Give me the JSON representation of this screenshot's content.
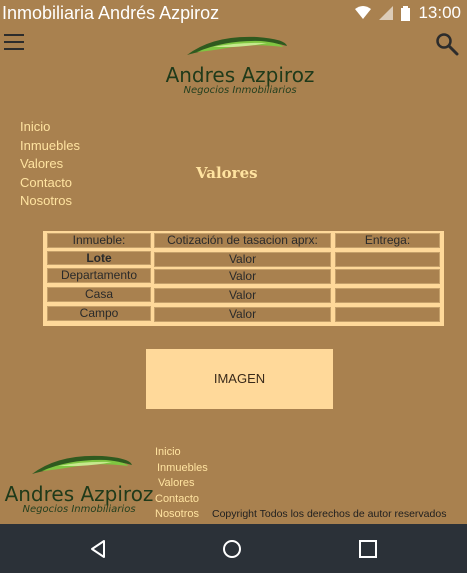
{
  "status_bar": {
    "title": "Inmobiliaria Andrés Azpiroz",
    "time": "13:00"
  },
  "logo": {
    "brand": "Andres Azpiroz",
    "tagline": "Negocios Inmobiliarios"
  },
  "side_nav": [
    "Inicio",
    "Inmuebles",
    "Valores",
    "Contacto",
    "Nosotros"
  ],
  "section_title": "Valores",
  "table": {
    "headers": [
      "Inmueble:",
      "Cotización de tasacion aprx:",
      "Entrega:"
    ],
    "rows": [
      {
        "inmueble": "Lote",
        "valor": "Valor",
        "entrega": ""
      },
      {
        "inmueble": "Departamento",
        "valor": "Valor",
        "entrega": ""
      },
      {
        "inmueble": "Casa",
        "valor": "Valor",
        "entrega": ""
      },
      {
        "inmueble": "Campo",
        "valor": "Valor",
        "entrega": ""
      }
    ]
  },
  "image_placeholder": "IMAGEN",
  "footer": {
    "nav": [
      "Inicio",
      "Inmuebles",
      "Valores",
      "Contacto",
      "Nosotros"
    ],
    "copyright": "Copyright Todos los derechos de autor reservados"
  },
  "icons": {
    "menu": "menu-icon",
    "search": "search-icon",
    "wifi": "wifi-icon",
    "signal": "signal-icon",
    "battery": "battery-icon",
    "back": "back-icon",
    "home": "home-icon",
    "recents": "recents-icon"
  },
  "colors": {
    "background": "#a9814f",
    "accent": "#ffd99a",
    "link": "#ffe3a0",
    "nav_bar": "#2b3138"
  }
}
